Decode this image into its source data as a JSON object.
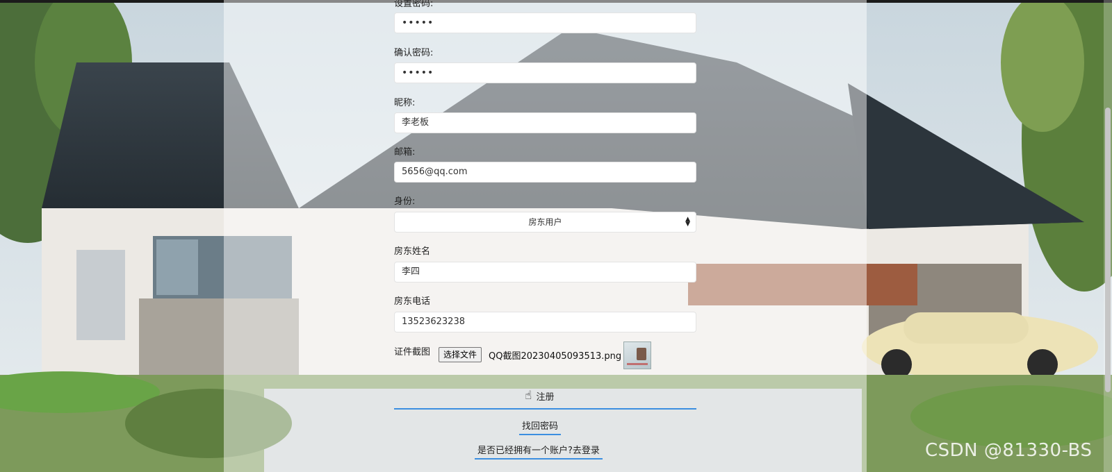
{
  "form": {
    "password_label": "设置密码:",
    "password_value": "•••••",
    "confirm_label": "确认密码:",
    "confirm_value": "•••••",
    "nickname_label": "昵称:",
    "nickname_value": "李老板",
    "email_label": "邮箱:",
    "email_value": "5656@qq.com",
    "identity_label": "身份:",
    "identity_value": "房东用户",
    "landlord_name_label": "房东姓名",
    "landlord_name_value": "李四",
    "landlord_phone_label": "房东电话",
    "landlord_phone_value": "13523623238",
    "id_screenshot_label": "证件截图",
    "file_button_label": "选择文件",
    "file_name": "QQ截图20230405093513.png",
    "register_label": "注册",
    "find_password_label": "找回密码",
    "login_link_label": "是否已经拥有一个账户?去登录"
  },
  "watermark": "CSDN @81330-BS",
  "colors": {
    "accent_underline": "#3b8ee0",
    "panel_overlay": "rgba(255,255,255,0.48)"
  },
  "icons": {
    "select_caret": "up-down-caret-icon",
    "cursor": "hand-pointer-icon"
  }
}
